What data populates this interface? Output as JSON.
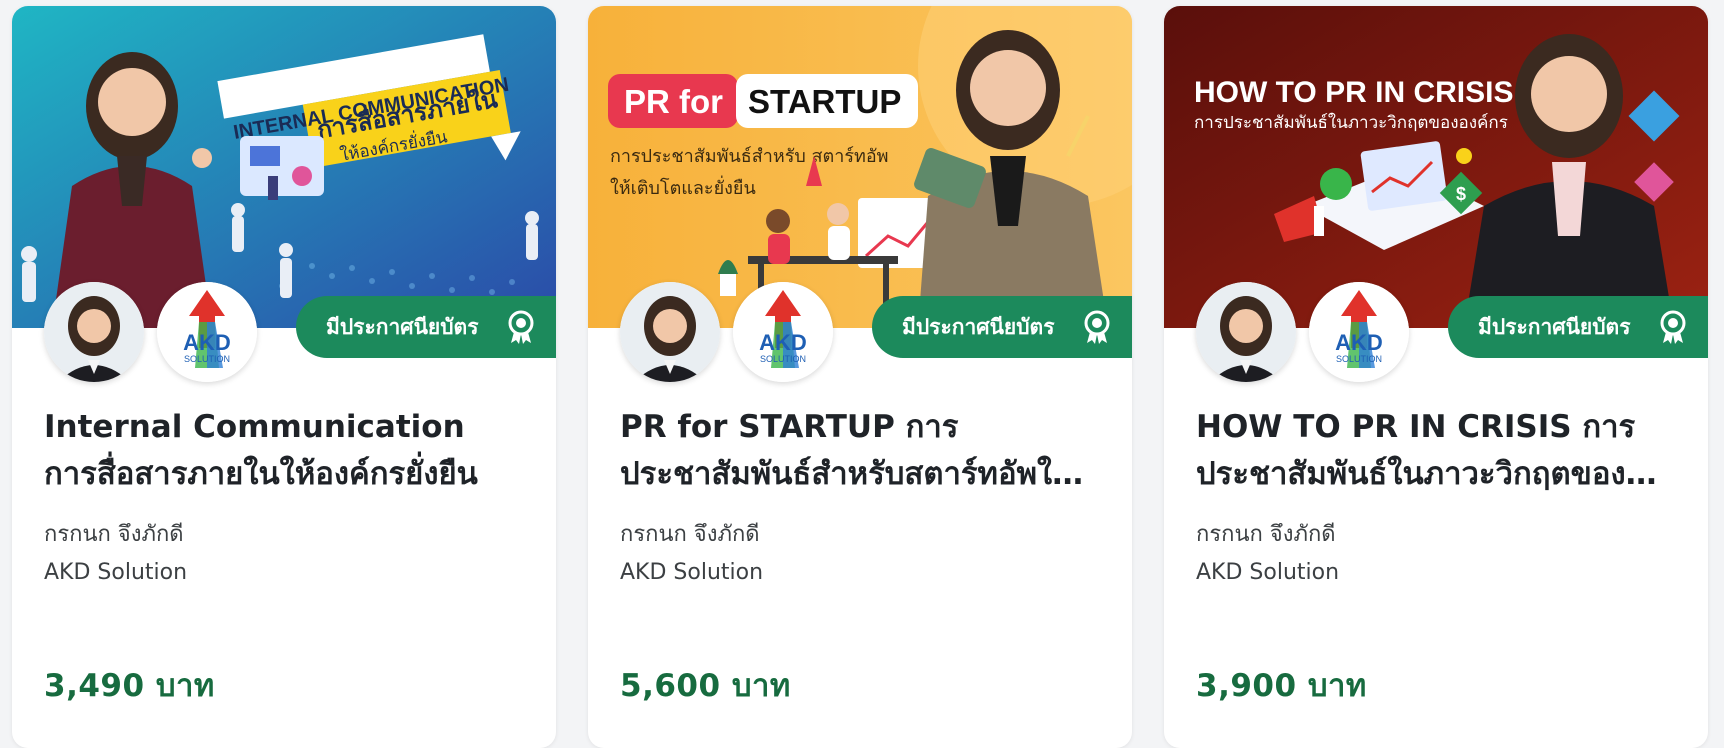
{
  "courses": [
    {
      "banner": {
        "headline": "INTERNAL COMMUNICATION",
        "subheadline": "การสื่อสารภายใน",
        "tagline": "ให้องค์กรยั่งยืน",
        "bg_from": "#1fb6c4",
        "bg_to": "#2b4aa8"
      },
      "certificate_label": "มีประกาศนียบัตร",
      "title": "Internal Communication การสื่อสารภายในให้องค์กรยั่งยืน",
      "instructor": "กรกนก จึงภักดี",
      "organization": "AKD Solution",
      "price": "3,490 บาท"
    },
    {
      "banner": {
        "headline_left": "PR for",
        "headline_right": "STARTUP",
        "subheadline": "การประชาสัมพันธ์สำหรับ สตาร์ทอัพ",
        "tagline": "ให้เติบโตและยั่งยืน",
        "bg_from": "#f7b13a",
        "bg_to": "#fbc660"
      },
      "certificate_label": "มีประกาศนียบัตร",
      "title": "PR for STARTUP การประชาสัมพันธ์สำหรับสตาร์ทอัพให้เติบโตและยั่งยืน",
      "instructor": "กรกนก จึงภักดี",
      "organization": "AKD Solution",
      "price": "5,600 บาท"
    },
    {
      "banner": {
        "headline": "HOW TO PR IN CRISIS",
        "subheadline": "การประชาสัมพันธ์ในภาวะวิกฤตขององค์กร",
        "bg_from": "#5a0f0b",
        "bg_to": "#9c2212"
      },
      "certificate_label": "มีประกาศนียบัตร",
      "title": "HOW TO PR IN CRISIS การประชาสัมพันธ์ในภาวะวิกฤตขององค์กร",
      "instructor": "กรกนก จึงภักดี",
      "organization": "AKD Solution",
      "price": "3,900 บาท"
    }
  ],
  "logo": {
    "line1": "AKD",
    "line2": "SOLUTION"
  },
  "colors": {
    "badge": "#1c8a5c",
    "price": "#176b3f",
    "title": "#1f2328"
  },
  "icons": {
    "certificate": "award-ribbon-icon"
  }
}
